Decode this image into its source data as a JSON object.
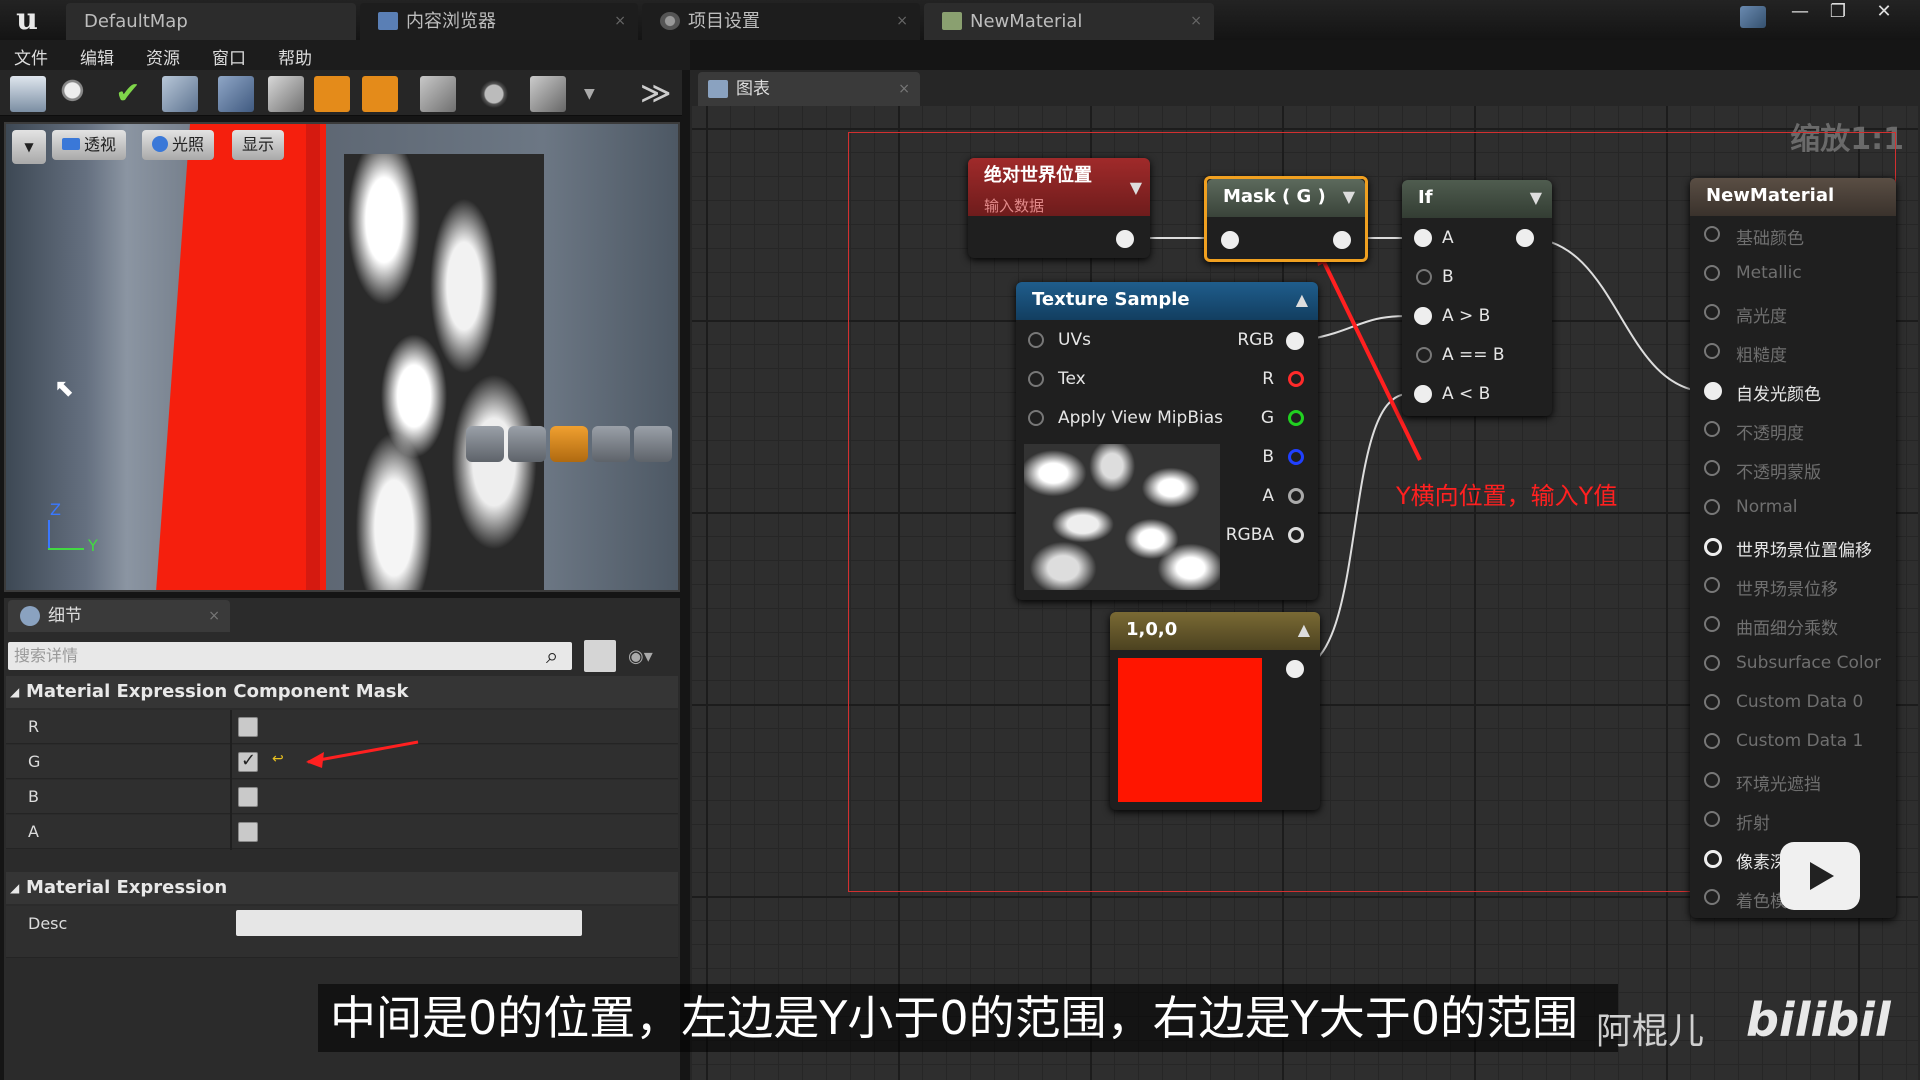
{
  "titlebar": {
    "tabs": [
      {
        "label": "DefaultMap"
      },
      {
        "label": "内容浏览器"
      },
      {
        "label": "项目设置"
      },
      {
        "label": "NewMaterial"
      }
    ],
    "window_buttons": [
      "—",
      "❐",
      "✕"
    ]
  },
  "menu": [
    "文件",
    "编辑",
    "资源",
    "窗口",
    "帮助"
  ],
  "viewport": {
    "buttons": [
      "透视",
      "光照",
      "显示"
    ],
    "axis_z": "Z",
    "axis_y": "Y"
  },
  "details": {
    "tab_label": "细节",
    "search_placeholder": "搜索详情",
    "category1": "Material Expression Component Mask",
    "rows": [
      {
        "label": "R",
        "checked": false
      },
      {
        "label": "G",
        "checked": true
      },
      {
        "label": "B",
        "checked": false
      },
      {
        "label": "A",
        "checked": false
      }
    ],
    "category2": "Material Expression",
    "desc_label": "Desc"
  },
  "graph": {
    "tab_label": "图表",
    "zoom": "缩放1:1",
    "nodes": {
      "world_pos": {
        "title": "绝对世界位置",
        "subtitle": "输入数据"
      },
      "mask": {
        "title": "Mask ( G )"
      },
      "if": {
        "title": "If",
        "pins": [
          "A",
          "B",
          "A > B",
          "A == B",
          "A < B"
        ]
      },
      "texture": {
        "title": "Texture Sample",
        "inputs": [
          "UVs",
          "Tex",
          "Apply View MipBias"
        ],
        "outputs": [
          "RGB",
          "R",
          "G",
          "B",
          "A",
          "RGBA"
        ]
      },
      "const": {
        "title": "1,0,0"
      },
      "material": {
        "title": "NewMaterial",
        "pins": [
          {
            "label": "基础颜色",
            "active": false
          },
          {
            "label": "Metallic",
            "active": false
          },
          {
            "label": "高光度",
            "active": false
          },
          {
            "label": "粗糙度",
            "active": false
          },
          {
            "label": "自发光颜色",
            "active": true
          },
          {
            "label": "不透明度",
            "active": false
          },
          {
            "label": "不透明蒙版",
            "active": false
          },
          {
            "label": "Normal",
            "active": false
          },
          {
            "label": "世界场景位置偏移",
            "active": true
          },
          {
            "label": "世界场景位移",
            "active": false
          },
          {
            "label": "曲面细分乘数",
            "active": false
          },
          {
            "label": "Subsurface Color",
            "active": false
          },
          {
            "label": "Custom Data 0",
            "active": false
          },
          {
            "label": "Custom Data 1",
            "active": false
          },
          {
            "label": "环境光遮挡",
            "active": false
          },
          {
            "label": "折射",
            "active": false
          },
          {
            "label": "像素深度偏移",
            "active": true
          },
          {
            "label": "着色模型",
            "active": false
          }
        ]
      }
    },
    "annotation": "Y横向位置，输入Y值"
  },
  "subtitle": "中间是0的位置，左边是Y小于0的范围，右边是Y大于0的范围",
  "watermark": "阿棍儿",
  "colors": {
    "accent": "#e48b1a",
    "annotation": "#ff2020",
    "constant": "#ff1500"
  }
}
